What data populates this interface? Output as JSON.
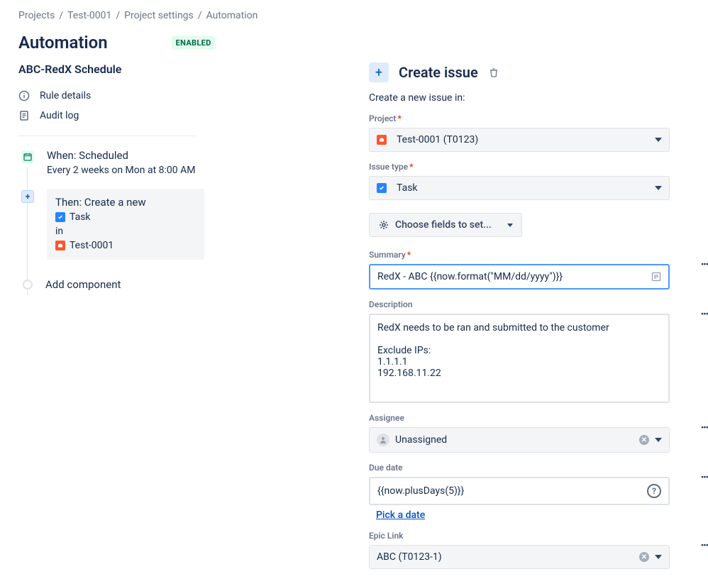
{
  "breadcrumbs": [
    "Projects",
    "Test-0001",
    "Project settings",
    "Automation"
  ],
  "page_title": "Automation",
  "status": "ENABLED",
  "rule_name": "ABC-RedX Schedule",
  "sidebar": {
    "rule_details": "Rule details",
    "audit_log": "Audit log",
    "when_title": "When: Scheduled",
    "when_sub": "Every 2 weeks on Mon at 8:00 AM",
    "then_title": "Then: Create a new",
    "then_task": "Task",
    "then_in": "in",
    "then_project": "Test-0001",
    "add_component": "Add component"
  },
  "panel": {
    "title": "Create issue",
    "subtitle": "Create a new issue in:",
    "project_label": "Project",
    "project_value": "Test-0001 (T0123)",
    "issuetype_label": "Issue type",
    "issuetype_value": "Task",
    "choose_fields": "Choose fields to set...",
    "summary_label": "Summary",
    "summary_value": "RedX - ABC {{now.format(\"MM/dd/yyyy\")}}",
    "description_label": "Description",
    "description_value": "RedX needs to be ran and submitted to the customer\n\nExclude IPs:\n1.1.1.1\n192.168.11.22",
    "assignee_label": "Assignee",
    "assignee_value": "Unassigned",
    "duedate_label": "Due date",
    "duedate_value": "{{now.plusDays(5)}}",
    "pick_date": "Pick a date",
    "epic_label": "Epic Link",
    "epic_value": "ABC (T0123-1)"
  }
}
